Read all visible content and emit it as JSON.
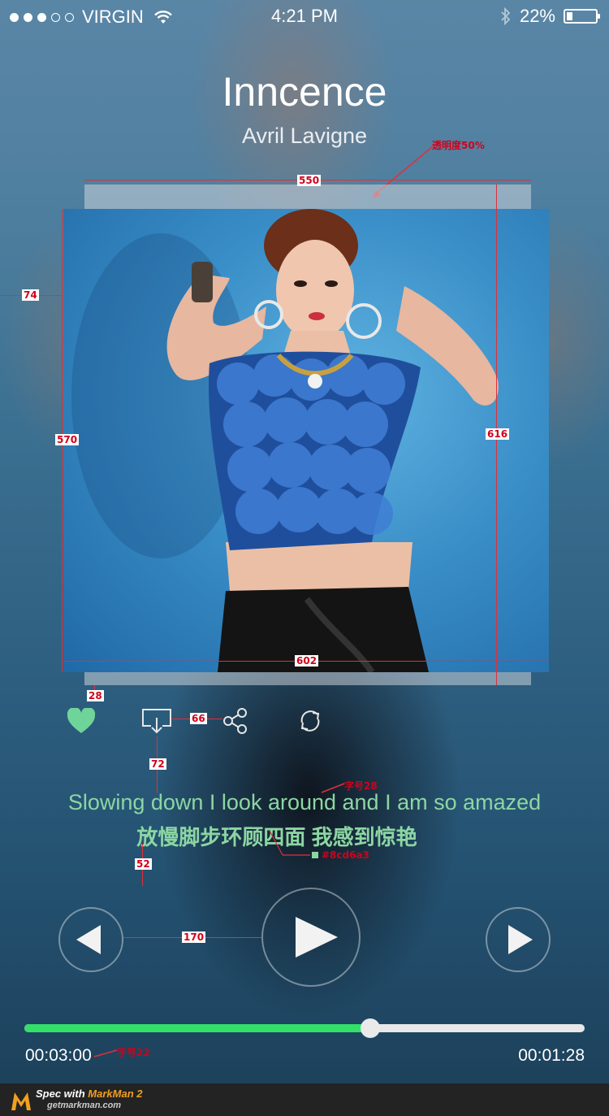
{
  "status_bar": {
    "carrier": "VIRGIN",
    "time": "4:21 PM",
    "battery": "22%",
    "signal_bars": 3
  },
  "song": {
    "title": "Inncence",
    "artist": "Avril Lavigne"
  },
  "annotations": {
    "opacity_note": "透明度50%",
    "card_width": "550",
    "card_height": "616",
    "art_width": "602",
    "art_height": "570",
    "left_margin": "74",
    "gap_under_card": "28",
    "icon_spacing": "66",
    "gap_icons_lyrics": "72",
    "font_size_lyrics": "字号28",
    "lyric_color_note": "#8cd6a3",
    "gap_lyrics_controls": "52",
    "control_spacing": "170",
    "font_size_time": "字号22"
  },
  "lyrics": {
    "line_en": "Slowing down I look around and I am so amazed",
    "line_zh": "放慢脚步环顾四面 我感到惊艳"
  },
  "player": {
    "elapsed": "00:03:00",
    "remaining": "00:01:28",
    "progress_fraction": 0.617
  },
  "icons": {
    "like": "heart-icon",
    "airplay": "airplay-icon",
    "share": "share-icon",
    "repeat": "repeat-icon",
    "prev": "previous-icon",
    "play": "play-icon",
    "next": "next-icon"
  },
  "colors": {
    "lyric_green": "#8cd6a3",
    "progress_green": "#32e06a",
    "heart_green": "#6fd49a"
  },
  "footer": {
    "brand_prefix": "Spec with ",
    "brand": "MarkMan 2",
    "url": "getmarkman.com"
  }
}
